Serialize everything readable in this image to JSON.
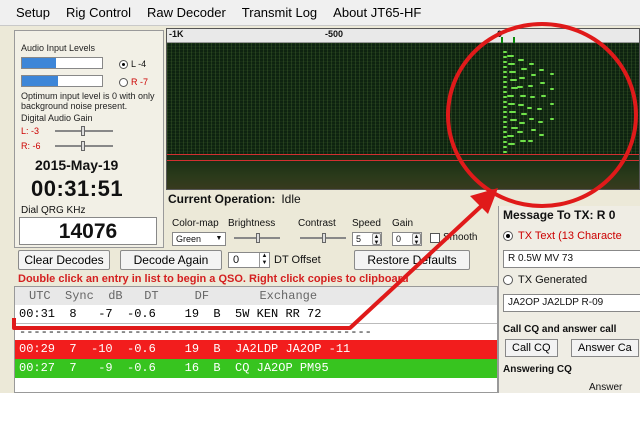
{
  "menu": [
    "Setup",
    "Rig Control",
    "Raw Decoder",
    "Transmit Log",
    "About JT65-HF"
  ],
  "audio": {
    "title": "Audio Input Levels",
    "left_label": "L -4",
    "right_label": "R -7",
    "left_level": 0.42,
    "right_level": 0.45,
    "note": "Optimum input level is 0 with only background noise present.",
    "gain_title": "Digital Audio Gain",
    "gain_l": "L: -3",
    "gain_r": "R: -6"
  },
  "date": "2015-May-19",
  "clock": "00:31:51",
  "dial": {
    "label": "Dial QRG KHz",
    "value": "14076"
  },
  "waterfall": {
    "ticks": [
      "-1K",
      "-500",
      "0"
    ]
  },
  "current_operation": {
    "label": "Current Operation:",
    "value": "Idle"
  },
  "controls": {
    "colormap_label": "Color-map",
    "colormap_value": "Green",
    "brightness_label": "Brightness",
    "contrast_label": "Contrast",
    "speed_label": "Speed",
    "speed_value": "5",
    "gain_label": "Gain",
    "gain_value": "0",
    "smooth_label": "Smooth"
  },
  "buttons": {
    "clear_decodes": "Clear Decodes",
    "decode_again": "Decode Again",
    "dt_value": "0",
    "dt_label": "DT Offset",
    "restore_defaults": "Restore Defaults"
  },
  "hint": "Double click an entry in list to begin a QSO.  Right click copies to clipboard",
  "decodes": {
    "header": "UTC  Sync  dB   DT     DF       Exchange",
    "rows": [
      {
        "text": "00:31  8   -7  -0.6    19  B  5W KEN RR 72",
        "bg": "#ffffff",
        "color": "#000000"
      },
      {
        "text": "00:29  7  -10  -0.6    19  B  JA2LDP JA2OP -11",
        "bg": "#f21d1d",
        "color": "#ffffff"
      },
      {
        "text": "00:27  7   -9  -0.6    16  B  CQ JA2OP PM95",
        "bg": "#37c41f",
        "color": "#ffffff"
      }
    ],
    "separator": "-------------------------------------------------"
  },
  "tx": {
    "title": "Message To TX: R 0",
    "tx_text_label": "TX Text (13 Characte",
    "tx_text_value": "R 0.5W MV 73",
    "tx_generated_label": "TX Generated",
    "tx_generated_value": "JA2OP JA2LDP R-09",
    "call_cq_label": "Call CQ and answer call",
    "call_cq_button": "Call CQ",
    "answer_button": "Answer Ca",
    "answering_label": "Answering CQ",
    "answer_bottom": "Answer"
  },
  "colors": {
    "annotation": "#e01a1a",
    "signal": "#6fe24a",
    "meter": "#3d86d8"
  }
}
